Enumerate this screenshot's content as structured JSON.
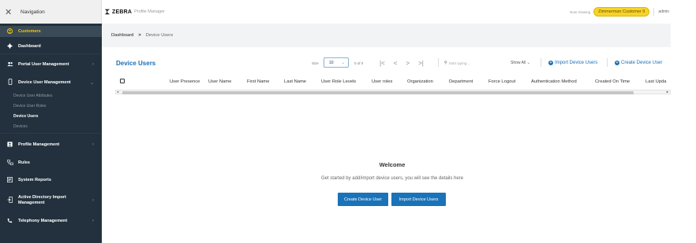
{
  "nav": {
    "close_icon": "close-icon",
    "title": "Navigation"
  },
  "brand": {
    "logo_text": "ZEBRA",
    "subtitle": "Profile Manager"
  },
  "topbar": {
    "now_viewing": "Now Viewing",
    "customer": "Zimmerman Customer 9",
    "user": "admin"
  },
  "sidebar": {
    "items": [
      {
        "label": "Customers",
        "icon": "user-circle-icon"
      },
      {
        "label": "Dashboard",
        "icon": "gear-icon"
      },
      {
        "label": "Portal User Management",
        "icon": "users-icon"
      },
      {
        "label": "Device User Management",
        "icon": "mobile-icon"
      },
      {
        "label": "Profile Management",
        "icon": "profile-icon"
      },
      {
        "label": "Rules",
        "icon": "rules-icon"
      },
      {
        "label": "System Reports",
        "icon": "report-icon"
      },
      {
        "label": "Active Directory Import",
        "label2": "Management",
        "icon": "import-icon"
      },
      {
        "label": "Telephony Management",
        "icon": "phone-icon"
      }
    ],
    "sub_items": [
      "Device User Attributes",
      "Device User Roles",
      "Device Users",
      "Devices"
    ],
    "accent": "#f6c800",
    "background": "#22313d"
  },
  "breadcrumb": {
    "root": "Dashboard",
    "separator": ">",
    "current": "Device Users"
  },
  "toolbar": {
    "title": "Device Users",
    "size_label": "Size",
    "size_value": "10",
    "count_label": "0 of 0",
    "pager": [
      "|<",
      "<",
      ">",
      ">|"
    ],
    "search_placeholder": "Start typing...",
    "show_all": "Show All",
    "import_link": "Import Device Users",
    "create_link": "Create Device User"
  },
  "table": {
    "columns": [
      "User Presence",
      "User Name",
      "First Name",
      "Last Name",
      "User Role Levels",
      "User roles",
      "Organization",
      "Department",
      "Force Logout",
      "Authentication Method",
      "Created On Time",
      "Last Upda"
    ]
  },
  "empty_state": {
    "title": "Welcome",
    "message": "Get started by add/import device users, you will see the details here",
    "create_button": "Create Device User",
    "import_button": "Import Device Users"
  },
  "colors": {
    "brand_blue": "#1a73b8",
    "badge_yellow": "#f6d328"
  }
}
